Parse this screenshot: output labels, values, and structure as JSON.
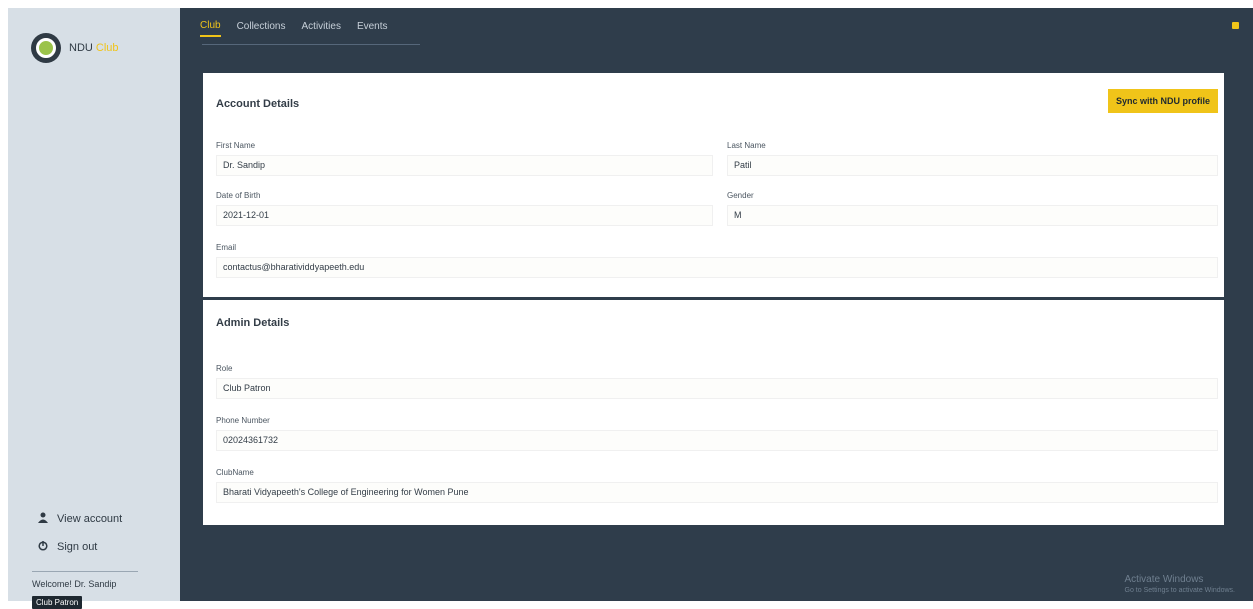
{
  "brand": {
    "name": "NDU",
    "accent": "Club"
  },
  "tabs": [
    "Club",
    "Collections",
    "Activities",
    "Events"
  ],
  "account": {
    "title": "Account Details",
    "sync_label": "Sync with NDU profile",
    "first_name_label": "First Name",
    "first_name": "Dr. Sandip",
    "last_name_label": "Last Name",
    "last_name": "Patil",
    "dob_label": "Date of Birth",
    "dob": "2021-12-01",
    "gender_label": "Gender",
    "gender": "M",
    "email_label": "Email",
    "email": "contactus@bharatividdyapeeth.edu"
  },
  "admin": {
    "title": "Admin Details",
    "role_label": "Role",
    "role": "Club Patron",
    "phone_label": "Phone Number",
    "phone": "02024361732",
    "club_label": "ClubName",
    "club": "Bharati Vidyapeeth's College of Engineering for Women Pune"
  },
  "sidebar": {
    "view_account": "View account",
    "sign_out": "Sign out",
    "welcome": "Welcome! Dr. Sandip",
    "role_badge": "Club Patron"
  },
  "watermark": {
    "title": "Activate Windows",
    "subtitle": "Go to Settings to activate Windows."
  },
  "colors": {
    "accent": "#f0c419",
    "main_bg": "#2f3d4b",
    "sidebar_bg": "#d7dfe6"
  }
}
